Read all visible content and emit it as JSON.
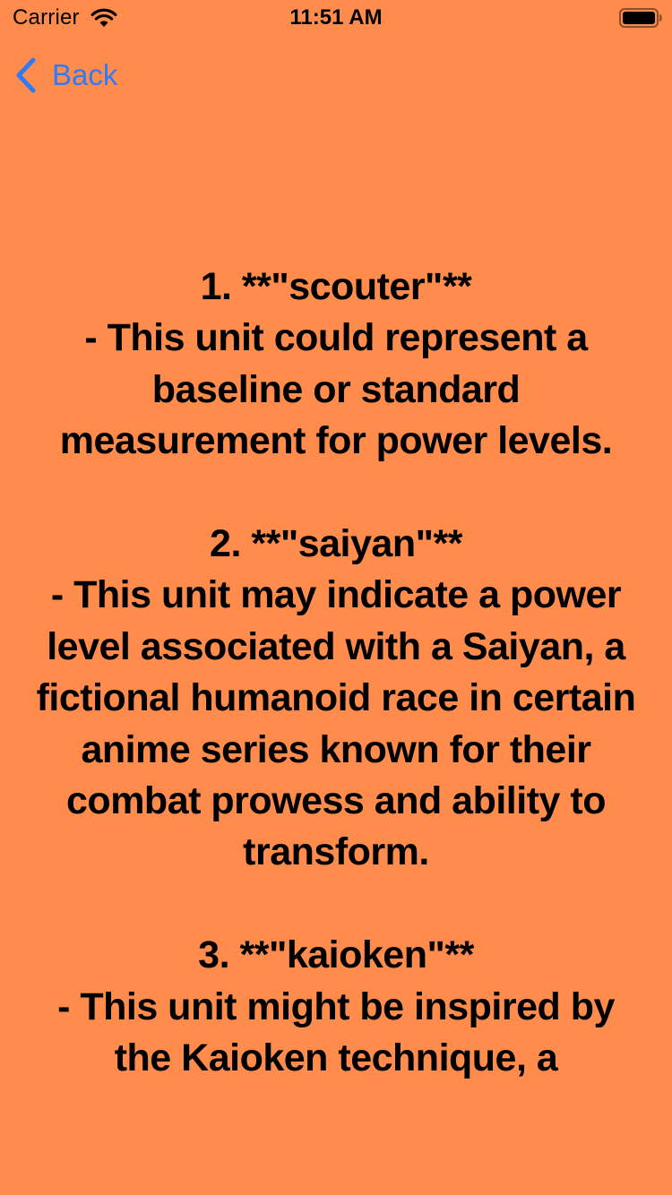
{
  "status_bar": {
    "carrier": "Carrier",
    "time": "11:51 AM",
    "icons": [
      "wifi-icon",
      "battery-icon"
    ]
  },
  "nav": {
    "back_label": "Back",
    "back_icon": "chevron-left-icon",
    "accent_color": "#2F7BF6"
  },
  "background_color": "#FF8C4C",
  "content": {
    "text": "1. **\"scouter\"**\n   - This unit could represent a baseline or standard measurement for power levels.\n\n2. **\"saiyan\"**\n   - This unit may indicate a power level associated with a Saiyan, a fictional humanoid race in certain anime series known for their combat prowess and ability to transform.\n\n3. **\"kaioken\"**\n   - This unit might be inspired by the Kaioken technique, a"
  }
}
